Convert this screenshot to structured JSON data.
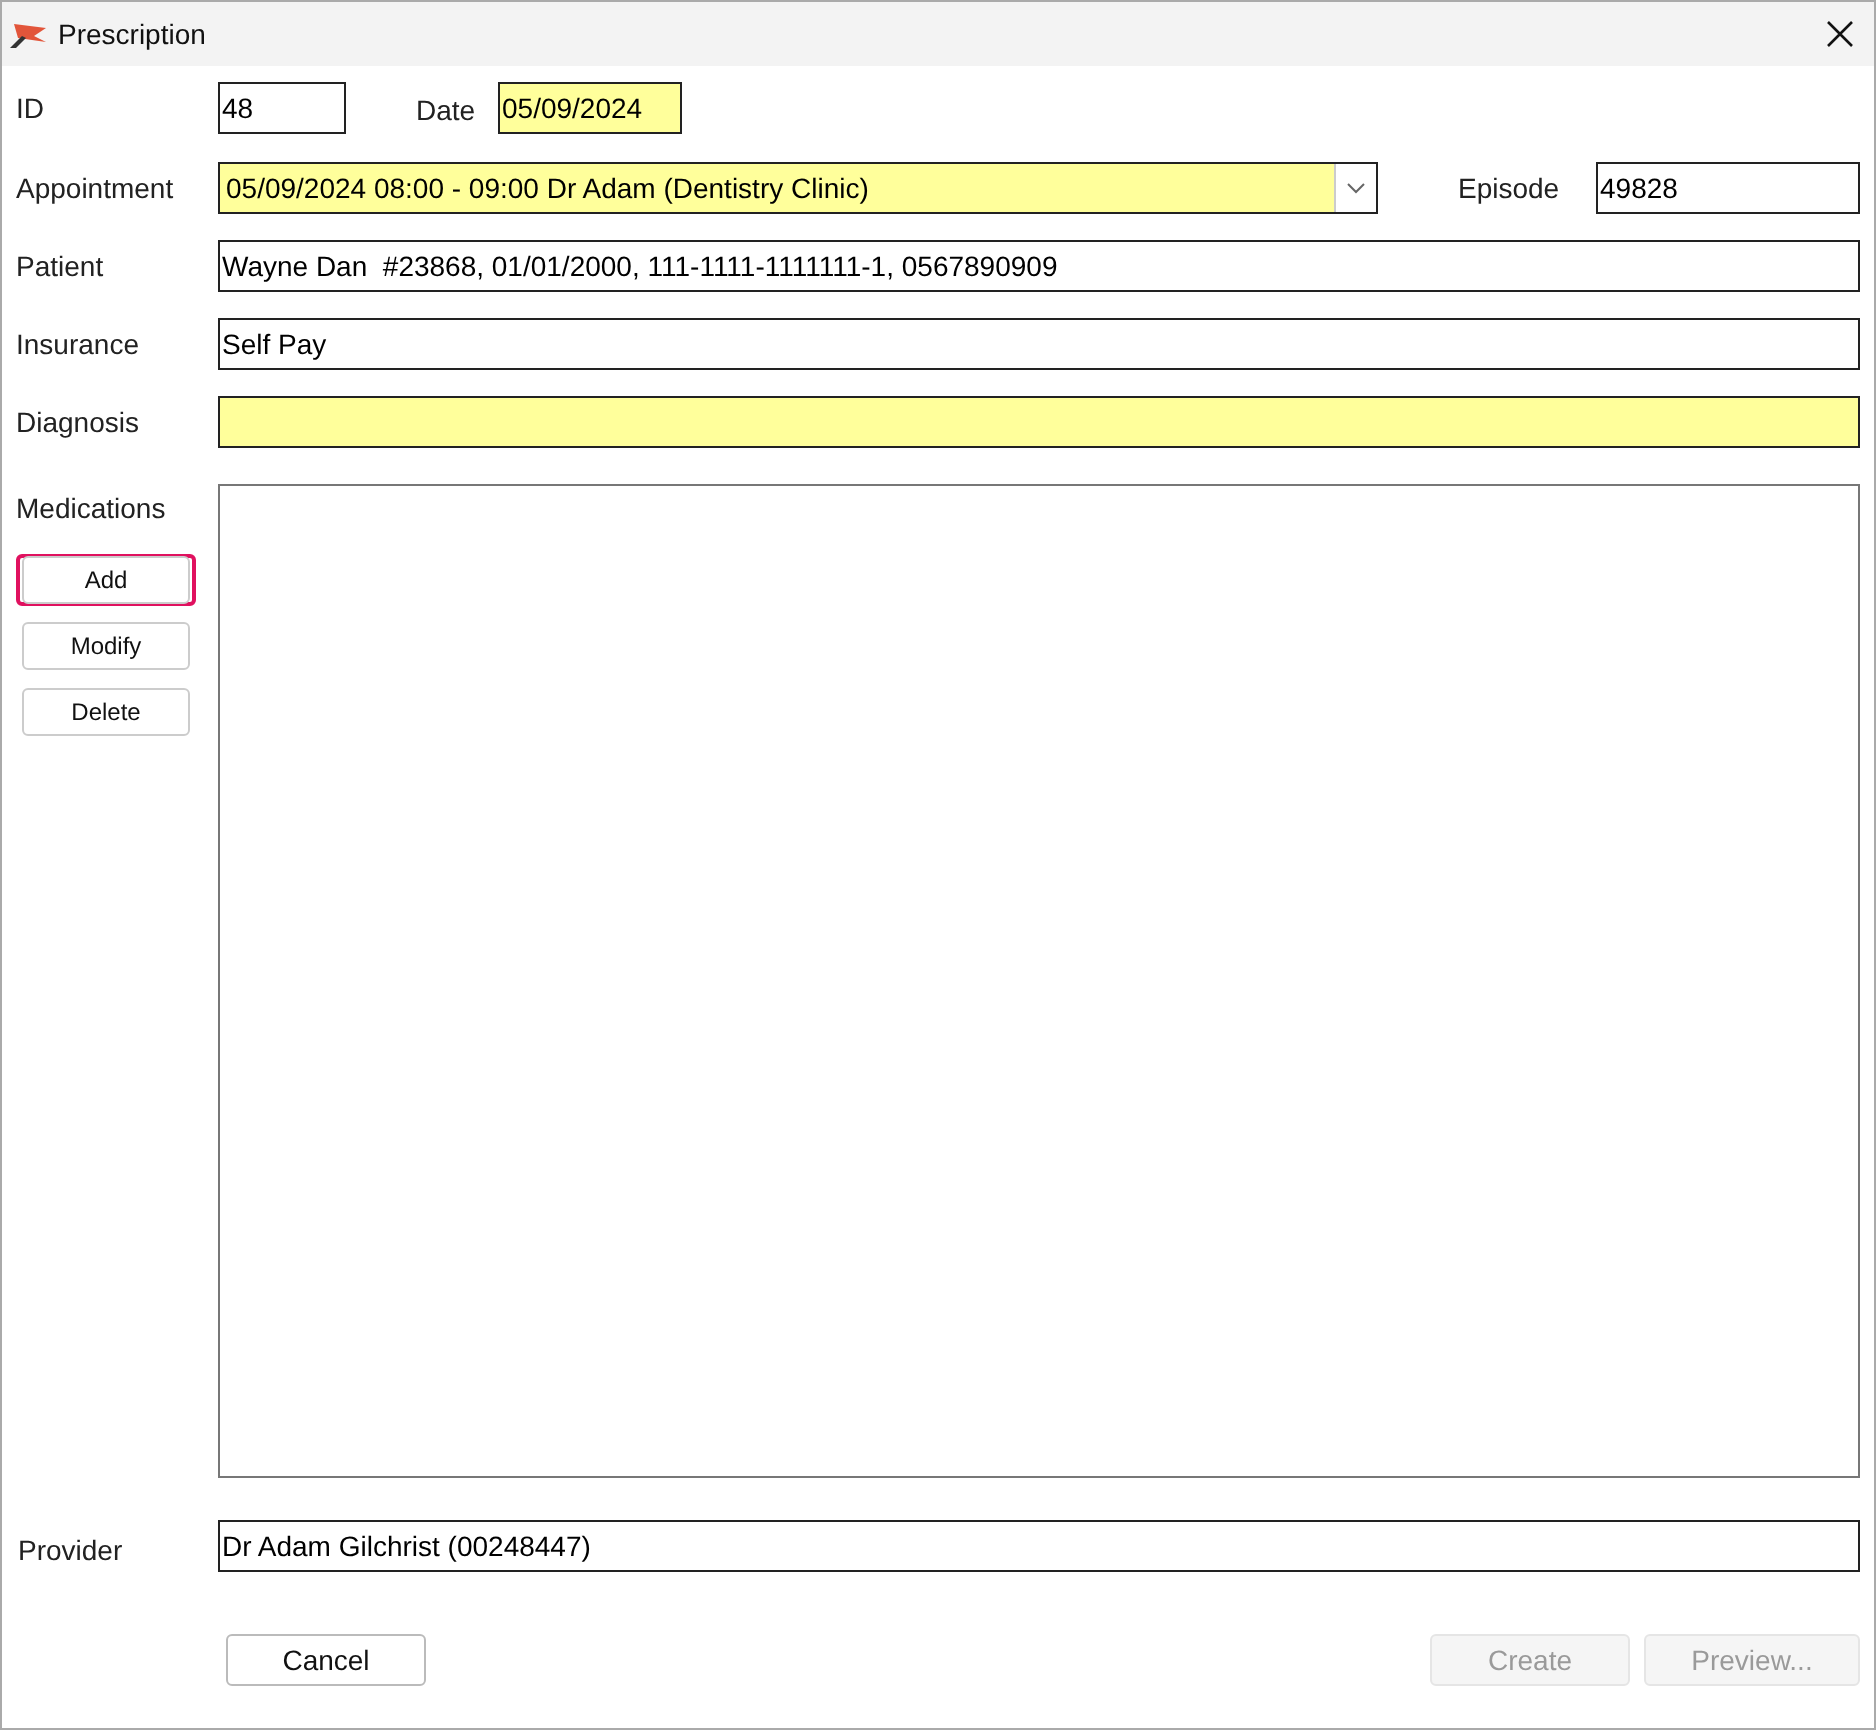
{
  "window": {
    "title": "Prescription"
  },
  "id_field": {
    "label": "ID",
    "value": "48",
    "required": false
  },
  "date_field": {
    "label": "Date",
    "value": "05/09/2024",
    "required": true
  },
  "appointment": {
    "label": "Appointment",
    "value": "05/09/2024 08:00 - 09:00 Dr Adam (Dentistry Clinic)",
    "required": true
  },
  "episode": {
    "label": "Episode",
    "value": "49828",
    "required": false
  },
  "fields": [
    {
      "label": "Patient",
      "value": "Wayne Dan  #23868, 01/01/2000, 111-1111-1111111-1, 0567890909",
      "required": false
    },
    {
      "label": "Insurance",
      "value": "Self Pay",
      "required": false
    },
    {
      "label": "Diagnosis",
      "required": true
    }
  ],
  "medications": {
    "label": "Medications",
    "buttons": [
      {
        "label": "Add",
        "highlighted": true
      },
      {
        "label": "Modify",
        "highlighted": false
      },
      {
        "label": "Delete",
        "highlighted": false
      }
    ]
  },
  "provider": {
    "label": "Provider",
    "value": "Dr Adam Gilchrist (00248447)",
    "required": false
  },
  "footer_buttons": [
    {
      "label": "Cancel",
      "disabled": false
    },
    {
      "label": "Create",
      "disabled": true
    },
    {
      "label": "Preview...",
      "disabled": true
    }
  ]
}
